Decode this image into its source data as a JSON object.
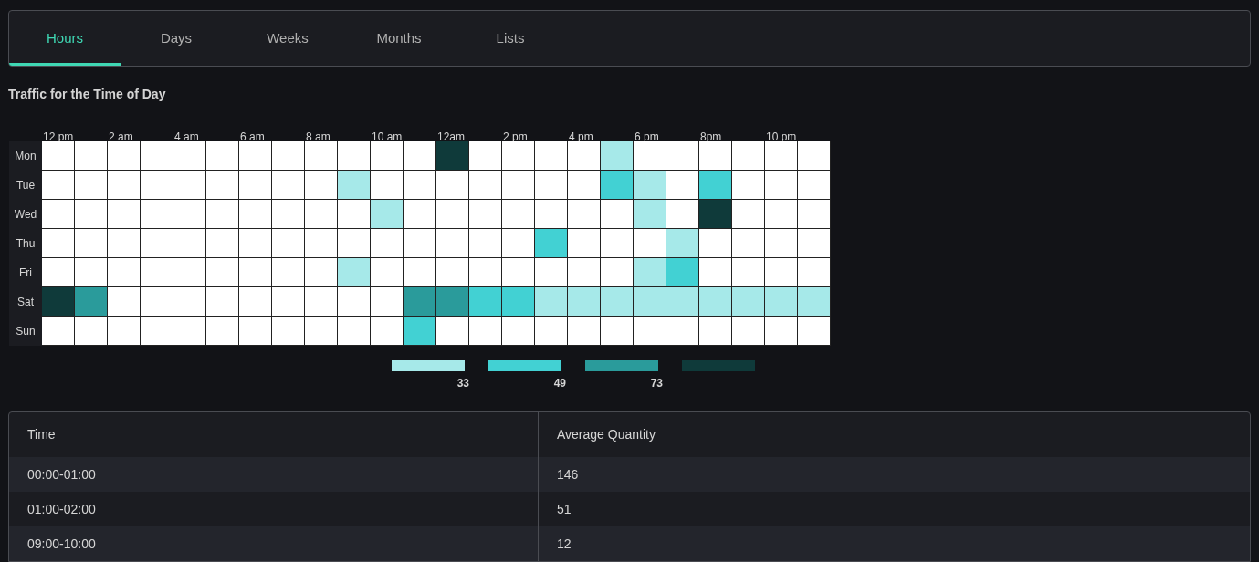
{
  "tabs": [
    {
      "label": "Hours",
      "selected": true
    },
    {
      "label": "Days",
      "selected": false
    },
    {
      "label": "Weeks",
      "selected": false
    },
    {
      "label": "Months",
      "selected": false
    },
    {
      "label": "Lists",
      "selected": false
    }
  ],
  "heatmap": {
    "title": "Traffic for the Time of Day",
    "hour_labels": [
      "12 pm",
      "2 am",
      "4 am",
      "6 am",
      "8 am",
      "10 am",
      "12am",
      "2 pm",
      "4 pm",
      "6 pm",
      "8pm",
      "10 pm"
    ],
    "rows": [
      {
        "label": "Mon",
        "cells": [
          {
            "color": "#ffffff"
          },
          {
            "color": "#ffffff"
          },
          {
            "color": "#ffffff"
          },
          {
            "color": "#ffffff"
          },
          {
            "color": "#ffffff"
          },
          {
            "color": "#ffffff"
          },
          {
            "color": "#ffffff"
          },
          {
            "color": "#ffffff"
          },
          {
            "color": "#ffffff"
          },
          {
            "color": "#ffffff"
          },
          {
            "color": "#ffffff"
          },
          {
            "color": "#ffffff"
          },
          {
            "color": "#0f3a3a"
          },
          {
            "color": "#ffffff"
          },
          {
            "color": "#ffffff"
          },
          {
            "color": "#ffffff"
          },
          {
            "color": "#ffffff"
          },
          {
            "color": "#a6e9e9"
          },
          {
            "color": "#ffffff"
          },
          {
            "color": "#ffffff"
          },
          {
            "color": "#ffffff"
          },
          {
            "color": "#ffffff"
          },
          {
            "color": "#ffffff"
          },
          {
            "color": "#ffffff"
          }
        ]
      },
      {
        "label": "Tue",
        "cells": [
          {
            "color": "#ffffff"
          },
          {
            "color": "#ffffff"
          },
          {
            "color": "#ffffff"
          },
          {
            "color": "#ffffff"
          },
          {
            "color": "#ffffff"
          },
          {
            "color": "#ffffff"
          },
          {
            "color": "#ffffff"
          },
          {
            "color": "#ffffff"
          },
          {
            "color": "#ffffff"
          },
          {
            "color": "#a6e9e9"
          },
          {
            "color": "#ffffff"
          },
          {
            "color": "#ffffff"
          },
          {
            "color": "#ffffff"
          },
          {
            "color": "#ffffff"
          },
          {
            "color": "#ffffff"
          },
          {
            "color": "#ffffff"
          },
          {
            "color": "#ffffff"
          },
          {
            "color": "#42d1d3"
          },
          {
            "color": "#a6e9e9"
          },
          {
            "color": "#ffffff"
          },
          {
            "color": "#42d1d3"
          },
          {
            "color": "#ffffff"
          },
          {
            "color": "#ffffff"
          },
          {
            "color": "#ffffff"
          }
        ]
      },
      {
        "label": "Wed",
        "cells": [
          {
            "color": "#ffffff"
          },
          {
            "color": "#ffffff"
          },
          {
            "color": "#ffffff"
          },
          {
            "color": "#ffffff"
          },
          {
            "color": "#ffffff"
          },
          {
            "color": "#ffffff"
          },
          {
            "color": "#ffffff"
          },
          {
            "color": "#ffffff"
          },
          {
            "color": "#ffffff"
          },
          {
            "color": "#ffffff"
          },
          {
            "color": "#a6e9e9"
          },
          {
            "color": "#ffffff"
          },
          {
            "color": "#ffffff"
          },
          {
            "color": "#ffffff"
          },
          {
            "color": "#ffffff"
          },
          {
            "color": "#ffffff"
          },
          {
            "color": "#ffffff"
          },
          {
            "color": "#ffffff"
          },
          {
            "color": "#a6e9e9"
          },
          {
            "color": "#ffffff"
          },
          {
            "color": "#0f3a3a"
          },
          {
            "color": "#ffffff"
          },
          {
            "color": "#ffffff"
          },
          {
            "color": "#ffffff"
          }
        ]
      },
      {
        "label": "Thu",
        "cells": [
          {
            "color": "#ffffff"
          },
          {
            "color": "#ffffff"
          },
          {
            "color": "#ffffff"
          },
          {
            "color": "#ffffff"
          },
          {
            "color": "#ffffff"
          },
          {
            "color": "#ffffff"
          },
          {
            "color": "#ffffff"
          },
          {
            "color": "#ffffff"
          },
          {
            "color": "#ffffff"
          },
          {
            "color": "#ffffff"
          },
          {
            "color": "#ffffff"
          },
          {
            "color": "#ffffff"
          },
          {
            "color": "#ffffff"
          },
          {
            "color": "#ffffff"
          },
          {
            "color": "#ffffff"
          },
          {
            "color": "#42d1d3"
          },
          {
            "color": "#ffffff"
          },
          {
            "color": "#ffffff"
          },
          {
            "color": "#ffffff"
          },
          {
            "color": "#a6e9e9"
          },
          {
            "color": "#ffffff"
          },
          {
            "color": "#ffffff"
          },
          {
            "color": "#ffffff"
          },
          {
            "color": "#ffffff"
          }
        ]
      },
      {
        "label": "Fri",
        "cells": [
          {
            "color": "#ffffff"
          },
          {
            "color": "#ffffff"
          },
          {
            "color": "#ffffff"
          },
          {
            "color": "#ffffff"
          },
          {
            "color": "#ffffff"
          },
          {
            "color": "#ffffff"
          },
          {
            "color": "#ffffff"
          },
          {
            "color": "#ffffff"
          },
          {
            "color": "#ffffff"
          },
          {
            "color": "#a6e9e9"
          },
          {
            "color": "#ffffff"
          },
          {
            "color": "#ffffff"
          },
          {
            "color": "#ffffff"
          },
          {
            "color": "#ffffff"
          },
          {
            "color": "#ffffff"
          },
          {
            "color": "#ffffff"
          },
          {
            "color": "#ffffff"
          },
          {
            "color": "#ffffff"
          },
          {
            "color": "#a6e9e9"
          },
          {
            "color": "#42d1d3"
          },
          {
            "color": "#ffffff"
          },
          {
            "color": "#ffffff"
          },
          {
            "color": "#ffffff"
          },
          {
            "color": "#ffffff"
          }
        ]
      },
      {
        "label": "Sat",
        "cells": [
          {
            "color": "#0f3a3a"
          },
          {
            "color": "#2a9b9b"
          },
          {
            "color": "#ffffff"
          },
          {
            "color": "#ffffff"
          },
          {
            "color": "#ffffff"
          },
          {
            "color": "#ffffff"
          },
          {
            "color": "#ffffff"
          },
          {
            "color": "#ffffff"
          },
          {
            "color": "#ffffff"
          },
          {
            "color": "#ffffff"
          },
          {
            "color": "#ffffff"
          },
          {
            "color": "#2a9b9b"
          },
          {
            "color": "#2a9b9b"
          },
          {
            "color": "#42d1d3"
          },
          {
            "color": "#42d1d3"
          },
          {
            "color": "#a6e9e9"
          },
          {
            "color": "#a6e9e9"
          },
          {
            "color": "#a6e9e9"
          },
          {
            "color": "#a6e9e9"
          },
          {
            "color": "#a6e9e9"
          },
          {
            "color": "#a6e9e9"
          },
          {
            "color": "#a6e9e9"
          },
          {
            "color": "#a6e9e9"
          },
          {
            "color": "#a6e9e9"
          }
        ]
      },
      {
        "label": "Sun",
        "cells": [
          {
            "color": "#ffffff"
          },
          {
            "color": "#ffffff"
          },
          {
            "color": "#ffffff"
          },
          {
            "color": "#ffffff"
          },
          {
            "color": "#ffffff"
          },
          {
            "color": "#ffffff"
          },
          {
            "color": "#ffffff"
          },
          {
            "color": "#ffffff"
          },
          {
            "color": "#ffffff"
          },
          {
            "color": "#ffffff"
          },
          {
            "color": "#ffffff"
          },
          {
            "color": "#42d1d3"
          },
          {
            "color": "#ffffff"
          },
          {
            "color": "#ffffff"
          },
          {
            "color": "#ffffff"
          },
          {
            "color": "#ffffff"
          },
          {
            "color": "#ffffff"
          },
          {
            "color": "#ffffff"
          },
          {
            "color": "#ffffff"
          },
          {
            "color": "#ffffff"
          },
          {
            "color": "#ffffff"
          },
          {
            "color": "#ffffff"
          },
          {
            "color": "#ffffff"
          },
          {
            "color": "#ffffff"
          }
        ]
      }
    ],
    "legend": [
      {
        "color": "#a6e9e9",
        "label": "33"
      },
      {
        "color": "#42d1d3",
        "label": "49"
      },
      {
        "color": "#2a9b9b",
        "label": "73"
      },
      {
        "color": "#0f3a3a"
      }
    ]
  },
  "table": {
    "columns": [
      "Time",
      "Average Quantity"
    ],
    "rows": [
      [
        "00:00-01:00",
        "146"
      ],
      [
        "01:00-02:00",
        "51"
      ],
      [
        "09:00-10:00",
        "12"
      ]
    ]
  }
}
